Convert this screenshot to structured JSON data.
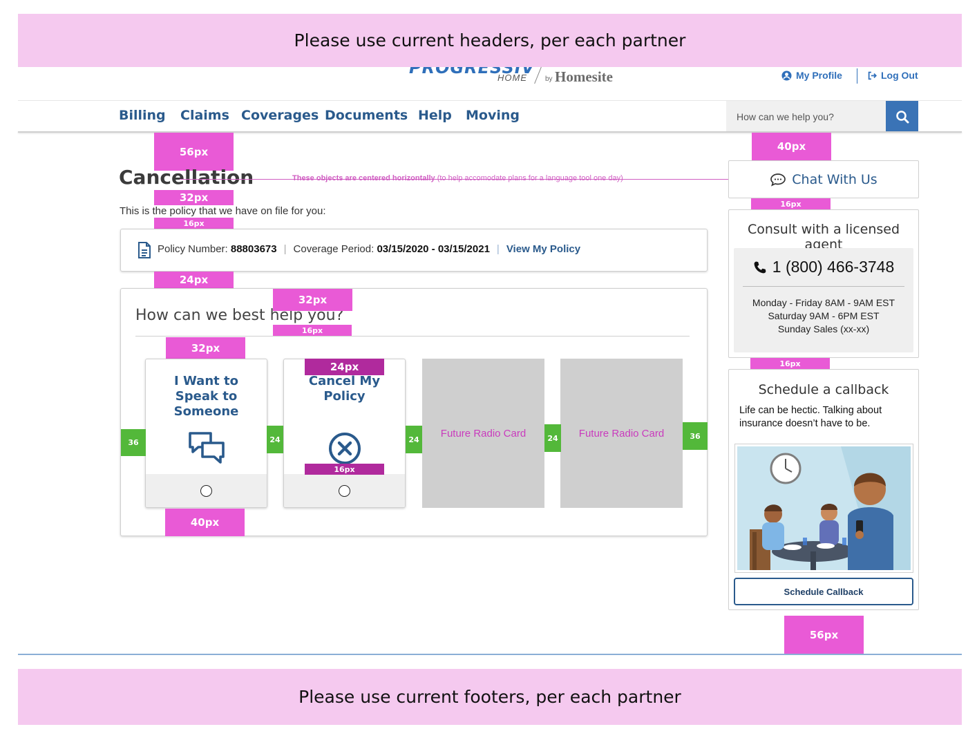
{
  "notes": {
    "header": "Please use current headers, per each partner",
    "footer": "Please use current footers, per each partner",
    "center": "These objects are centered horizontally",
    "center_sub": "(to help accomodate plans for a language tool one day)"
  },
  "brand": {
    "progressive": "PROGRESSIVE",
    "home": "HOME",
    "by": "by",
    "homesite": "Homesite"
  },
  "header": {
    "my_profile": "My Profile",
    "log_out": "Log Out"
  },
  "nav": {
    "items": [
      "Billing",
      "Claims",
      "Coverages",
      "Documents",
      "Help",
      "Moving"
    ]
  },
  "search": {
    "placeholder": "How can we help you?"
  },
  "page": {
    "title": "Cancellation",
    "intro": "This is the policy that we have on file for you:"
  },
  "policy": {
    "number_label": "Policy Number:",
    "number": "88803673",
    "period_label": "Coverage Period:",
    "period": "03/15/2020 - 03/15/2021",
    "view_link": "View My Policy"
  },
  "help": {
    "title": "How can we best help you?",
    "options": [
      {
        "label": "I Want to Speak to Someone",
        "icon": "chat-bubbles-icon"
      },
      {
        "label": "Cancel My Policy",
        "icon": "cancel-circle-icon"
      }
    ],
    "future": [
      "Future Radio Card",
      "Future Radio Card"
    ]
  },
  "sidebar": {
    "chat": "Chat With Us",
    "consult_title": "Consult with a licensed agent",
    "phone": "1 (800) 466-3748",
    "hours": [
      "Monday - Friday 8AM - 9AM EST",
      "Saturday 9AM - 6PM EST",
      "Sunday Sales (xx-xx)"
    ],
    "callback_title": "Schedule a callback",
    "callback_text": "Life can be hectic. Talking about insurance doesn’t have to be.",
    "callback_button": "Schedule Callback"
  },
  "spacing": {
    "s56": "56px",
    "s32": "32px",
    "s16": "16px",
    "s24": "24px",
    "s40": "40px",
    "g36": "36",
    "g24": "24"
  },
  "colors": {
    "brand_blue": "#2f6fba",
    "nav_blue": "#2a5a8c",
    "annotation_pink": "#e95ad6",
    "annotation_green": "#53b83a",
    "note_band": "#f5c9ef"
  }
}
